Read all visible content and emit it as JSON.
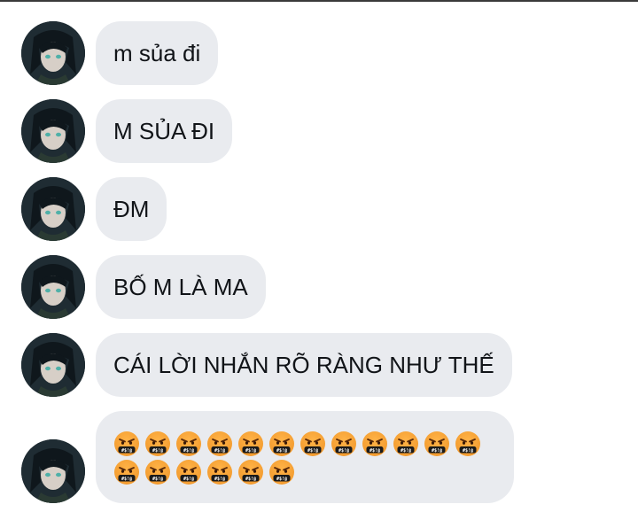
{
  "messages": [
    {
      "text": "m sủa đi"
    },
    {
      "text": "M SỦA ĐI"
    },
    {
      "text": "ĐM"
    },
    {
      "text": "BỐ M LÀ MA"
    },
    {
      "text": "CÁI LỜI NHẮN RÕ RÀNG NHƯ THẾ"
    }
  ],
  "emoji_message": {
    "emoji": "face-with-symbols-on-mouth",
    "count": 18,
    "symbols_text": "#$!@"
  },
  "colors": {
    "bubble": "#e9ebef",
    "text": "#111418",
    "emoji_face": "#f29a2e",
    "avatar_bg": "#1d2a30"
  }
}
